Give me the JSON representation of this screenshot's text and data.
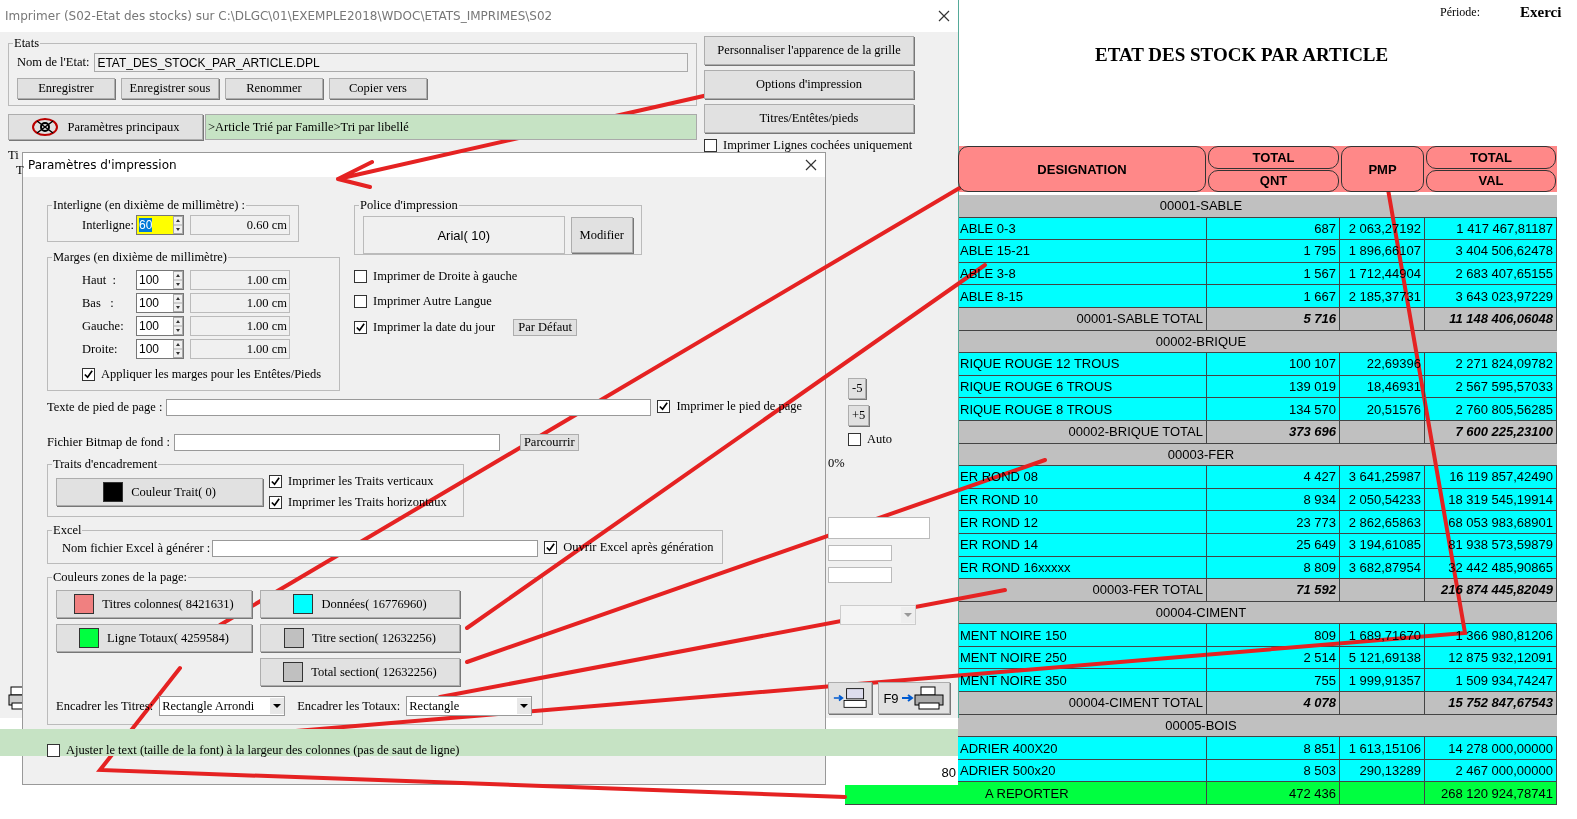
{
  "main_window": {
    "title": "Imprimer (S02-Etat des stocks)  sur C:\\DLGC\\01\\EXEMPLE2018\\WDOC\\ETATS_IMPRIMES\\S02",
    "etats": {
      "legend": "Etats",
      "name_label": "Nom de l'Etat:",
      "name_value": "ETAT_DES_STOCK_PAR_ARTICLE.DPL",
      "buttons": [
        "Enregistrer",
        "Enregistrer sous",
        "Renommer",
        "Copier vers"
      ]
    },
    "side_buttons": [
      "Personnaliser l'apparence de la grille",
      "Options d'impression",
      "Titres/Entêtes/pieds"
    ],
    "checked_only": {
      "label": "Imprimer Lignes cochées uniquement",
      "checked": false
    },
    "params_button": "Paramètres principaux",
    "breadcrumb": ">Article Trié par Famille>Tri par libellé",
    "hidden_legend": "Ti",
    "hidden_label": "T",
    "step_buttons": [
      "-5",
      "+5"
    ],
    "auto": {
      "label": "Auto",
      "checked": false
    },
    "percent": "0%",
    "f9_label": "F9",
    "page_number": "80"
  },
  "dialog": {
    "title": "Paramètres d'impression",
    "interligne": {
      "legend": "Interligne (en dixième de millimètre) :",
      "label": "Interligne:",
      "value": "60",
      "readout": "0.60 cm"
    },
    "marges": {
      "legend": "Marges (en dixième de millimètre)",
      "rows": [
        {
          "label": "Haut  :",
          "value": "100",
          "readout": "1.00 cm"
        },
        {
          "label": "Bas   :",
          "value": "100",
          "readout": "1.00 cm"
        },
        {
          "label": "Gauche:",
          "value": "100",
          "readout": "1.00 cm"
        },
        {
          "label": "Droite:",
          "value": "100",
          "readout": "1.00 cm"
        }
      ],
      "apply": {
        "label": "Appliquer les marges pour les Entêtes/Pieds",
        "checked": true
      }
    },
    "police": {
      "legend": "Police d'impression",
      "font": "Arial( 10)",
      "button": "Modifier"
    },
    "options": [
      {
        "label": "Imprimer de Droite à gauche",
        "checked": false
      },
      {
        "label": "Imprimer Autre Langue",
        "checked": false
      },
      {
        "label": "Imprimer la date du jour",
        "checked": true
      }
    ],
    "default_button": "Par Défaut",
    "footer": {
      "label": "Texte de pied de page :",
      "print": {
        "label": "Imprimer le pied de page",
        "checked": true
      }
    },
    "bitmap": {
      "label": "Fichier Bitmap de fond :",
      "button": "Parcourrir"
    },
    "traits": {
      "legend": "Traits d'encadrement",
      "color_button": {
        "label": "Couleur Trait( 0)",
        "color": "#000000"
      },
      "options": [
        {
          "label": "Imprimer les Traits verticaux",
          "checked": true
        },
        {
          "label": "Imprimer les Traits horizontaux",
          "checked": true
        }
      ]
    },
    "excel": {
      "legend": "Excel",
      "label": "Nom fichier Excel à générer :",
      "open": {
        "label": "Ouvrir Excel après génération",
        "checked": true
      }
    },
    "colors": {
      "legend": "Couleurs zones de la page:",
      "buttons": [
        {
          "label": "Titres colonnes( 8421631)",
          "color": "#f08080"
        },
        {
          "label": "Données( 16776960)",
          "color": "#00ffff"
        },
        {
          "label": "Ligne Totaux( 4259584)",
          "color": "#00ff40"
        },
        {
          "label": "Titre section( 12632256)",
          "color": "#c0c0c0"
        },
        {
          "label": "Total section( 12632256)",
          "color": "#c0c0c0"
        }
      ],
      "frame_titles": {
        "label": "Encadrer les Titres:",
        "value": "Rectangle Arrondi"
      },
      "frame_totals": {
        "label": "Encadrer les Totaux:",
        "value": "Rectangle"
      }
    },
    "fit_text": {
      "label": "Ajuster le text (taille de la font) à la largeur des colonnes (pas de saut de ligne)",
      "checked": false
    }
  },
  "report": {
    "period_label": "Période:",
    "period_value": "Exerci",
    "title": "ETAT DES STOCK PAR ARTICLE",
    "columns": [
      {
        "lines": [
          "DESIGNATION"
        ]
      },
      {
        "lines": [
          "TOTAL",
          "QNT"
        ]
      },
      {
        "lines": [
          "PMP"
        ]
      },
      {
        "lines": [
          "TOTAL",
          "VAL"
        ]
      }
    ],
    "rows": [
      {
        "kind": "section",
        "label": "00001-SABLE"
      },
      {
        "kind": "data",
        "designation": "ABLE 0-3",
        "qnt": "687",
        "pmp": "2 063,27192",
        "val": "1 417 467,81187"
      },
      {
        "kind": "data",
        "designation": "ABLE 15-21",
        "qnt": "1 795",
        "pmp": "1 896,66107",
        "val": "3 404 506,62478"
      },
      {
        "kind": "data",
        "designation": "ABLE 3-8",
        "qnt": "1 567",
        "pmp": "1 712,44904",
        "val": "2 683 407,65155"
      },
      {
        "kind": "data",
        "designation": "ABLE 8-15",
        "qnt": "1 667",
        "pmp": "2 185,37731",
        "val": "3 643 023,97229"
      },
      {
        "kind": "total",
        "designation": "00001-SABLE  TOTAL",
        "qnt": "5 716",
        "val": "11 148 406,06048"
      },
      {
        "kind": "section",
        "label": "00002-BRIQUE"
      },
      {
        "kind": "data",
        "designation": "RIQUE ROUGE 12 TROUS",
        "qnt": "100 107",
        "pmp": "22,69396",
        "val": "2 271 824,09782"
      },
      {
        "kind": "data",
        "designation": "RIQUE ROUGE 6 TROUS",
        "qnt": "139 019",
        "pmp": "18,46931",
        "val": "2 567 595,57033"
      },
      {
        "kind": "data",
        "designation": "RIQUE ROUGE 8 TROUS",
        "qnt": "134 570",
        "pmp": "20,51576",
        "val": "2 760 805,56285"
      },
      {
        "kind": "total",
        "designation": "00002-BRIQUE  TOTAL",
        "qnt": "373 696",
        "val": "7 600 225,23100"
      },
      {
        "kind": "section",
        "label": "00003-FER"
      },
      {
        "kind": "data",
        "designation": "ER ROND 08",
        "qnt": "4 427",
        "pmp": "3 641,25987",
        "val": "16 119 857,42490"
      },
      {
        "kind": "data",
        "designation": "ER ROND 10",
        "qnt": "8 934",
        "pmp": "2 050,54233",
        "val": "18 319 545,19914"
      },
      {
        "kind": "data",
        "designation": "ER ROND 12",
        "qnt": "23 773",
        "pmp": "2 862,65863",
        "val": "68 053 983,68901"
      },
      {
        "kind": "data",
        "designation": "ER ROND 14",
        "qnt": "25 649",
        "pmp": "3 194,61085",
        "val": "81 938 573,59879"
      },
      {
        "kind": "data",
        "designation": "ER ROND 16xxxxx",
        "qnt": "8 809",
        "pmp": "3 682,87954",
        "val": "32 442 485,90865"
      },
      {
        "kind": "total",
        "designation": "00003-FER  TOTAL",
        "qnt": "71 592",
        "val": "216 874 445,82049"
      },
      {
        "kind": "section",
        "label": "00004-CIMENT"
      },
      {
        "kind": "data",
        "designation": "MENT NOIRE 150",
        "qnt": "809",
        "pmp": "1 689,71670",
        "val": "1 366 980,81206"
      },
      {
        "kind": "data",
        "designation": "MENT NOIRE 250",
        "qnt": "2 514",
        "pmp": "5 121,69138",
        "val": "12 875 932,12091"
      },
      {
        "kind": "data",
        "designation": "MENT NOIRE 350",
        "qnt": "755",
        "pmp": "1 999,91357",
        "val": "1 509 934,74247"
      },
      {
        "kind": "total",
        "designation": "00004-CIMENT  TOTAL",
        "qnt": "4 078",
        "val": "15 752 847,67543"
      },
      {
        "kind": "section",
        "label": "00005-BOIS"
      },
      {
        "kind": "data",
        "designation": "ADRIER 400X20",
        "qnt": "8 851",
        "pmp": "1 613,15106",
        "val": "14 278 000,00000"
      },
      {
        "kind": "data",
        "designation": "ADRIER 500x20",
        "qnt": "8 503",
        "pmp": "290,13289",
        "val": "2 467 000,00000"
      },
      {
        "kind": "carry",
        "designation": "A REPORTER",
        "qnt": "472 436",
        "val": "268 120 924,78741"
      }
    ]
  }
}
